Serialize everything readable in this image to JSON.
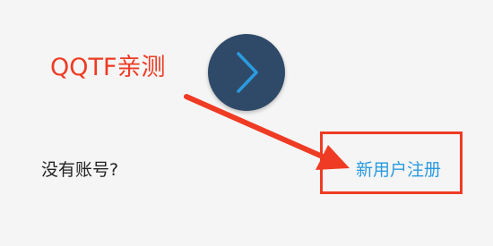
{
  "annotation": {
    "label": "QQTF亲测"
  },
  "login": {
    "next_icon": "chevron-right-icon",
    "no_account_text": "没有账号?",
    "register_label": "新用户注册"
  },
  "colors": {
    "button_bg": "#2f4a68",
    "chevron": "#2a9be0",
    "link": "#2a9be0",
    "annotation": "#ef3b24",
    "text": "#222222",
    "background": "#f5f5f5"
  }
}
